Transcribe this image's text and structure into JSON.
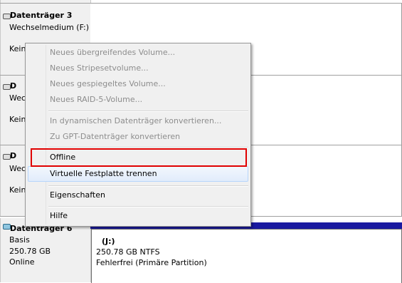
{
  "disks": [
    {
      "name": "Datenträger 3",
      "type": "Wechselmedium (F:)",
      "status": "Kein"
    },
    {
      "name": "D",
      "type": "Wec",
      "status": "Kein"
    },
    {
      "name": "D",
      "type": "Wec",
      "status": "Kein"
    },
    {
      "name": "Datenträger 6",
      "type": "Basis",
      "size": "250.78 GB",
      "status": "Online"
    }
  ],
  "partition": {
    "drive": "(J:)",
    "size_fs": "250.78 GB NTFS",
    "health": "Fehlerfrei (Primäre Partition)"
  },
  "context_menu": {
    "items": [
      {
        "label": "Neues übergreifendes Volume...",
        "enabled": false
      },
      {
        "label": "Neues Stripesetvolume...",
        "enabled": false
      },
      {
        "label": "Neues gespiegeltes Volume...",
        "enabled": false
      },
      {
        "label": "Neues RAID-5-Volume...",
        "enabled": false
      },
      {
        "label": "In dynamischen Datenträger konvertieren...",
        "enabled": false
      },
      {
        "label": "Zu GPT-Datenträger konvertieren",
        "enabled": false
      },
      {
        "label": "Offline",
        "enabled": true
      },
      {
        "label": "Virtuelle Festplatte trennen",
        "enabled": true
      },
      {
        "label": "Eigenschaften",
        "enabled": true
      },
      {
        "label": "Hilfe",
        "enabled": true
      }
    ]
  },
  "colors": {
    "highlight_box": "#e00000",
    "partition_header": "#1a1aa0",
    "disabled_text": "#8d8d8d"
  }
}
